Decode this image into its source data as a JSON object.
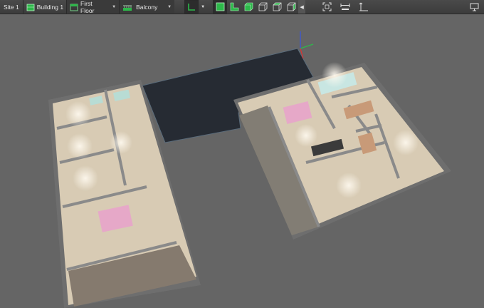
{
  "toolbar": {
    "site_label": "Site 1",
    "building_label": "Building 1",
    "floor_label": "First Floor",
    "area_label": "Balcony"
  },
  "icons": {
    "building": "building-icon",
    "floor": "floor-icon",
    "balcony": "balcony-icon",
    "wall_tool": "wall-tool-icon",
    "box_solid": "box-solid-icon",
    "l_shape": "l-shape-icon",
    "box_outline": "box-outline-icon",
    "collapse": "collapse-arrow-icon",
    "fit_view": "fit-view-icon",
    "dimension": "dimension-icon",
    "measure": "measure-icon",
    "monitor": "monitor-icon"
  },
  "colors": {
    "toolbar_bg": "#434343",
    "viewport_bg": "#656565",
    "accent_green": "#2db84a",
    "floor_beige": "#d9cbb4",
    "wall_grey": "#9a9a9a"
  }
}
